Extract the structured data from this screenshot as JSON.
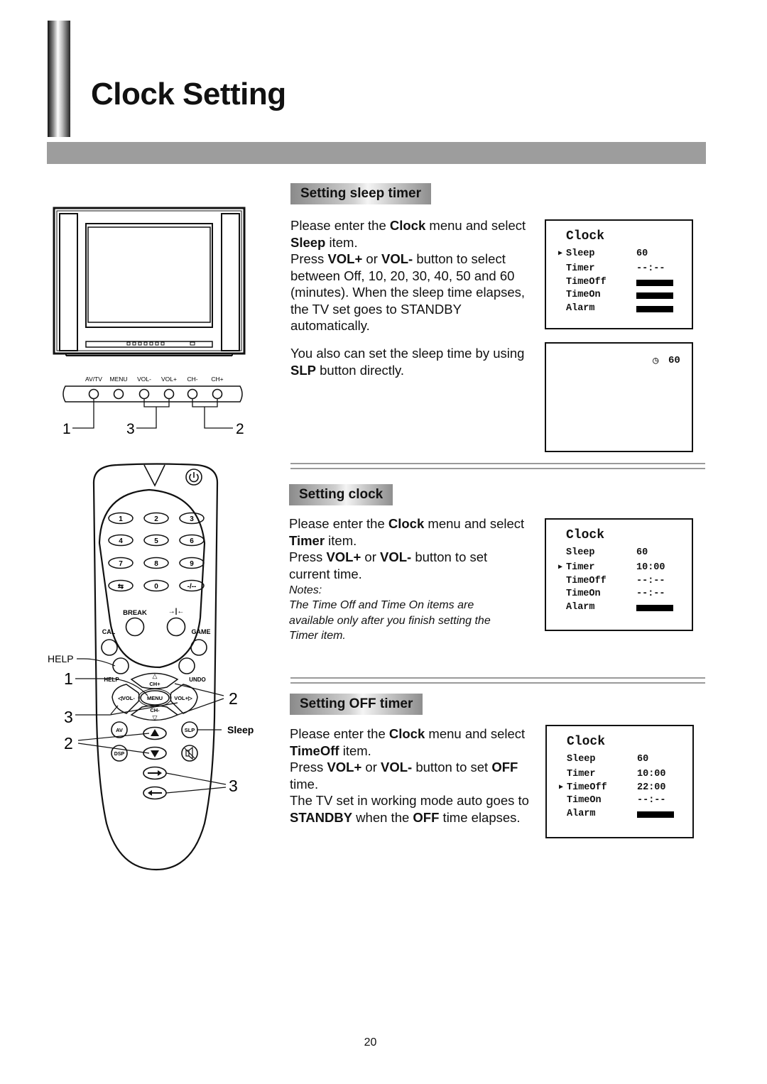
{
  "page": {
    "title": "Clock Setting",
    "page_number": "20"
  },
  "tv_diagram": {
    "panel_buttons": [
      "AV/TV",
      "MENU",
      "VOL-",
      "VOL+",
      "CH-",
      "CH+"
    ],
    "callouts": [
      "1",
      "3",
      "2"
    ]
  },
  "remote_diagram": {
    "keypad": [
      "1",
      "2",
      "3",
      "4",
      "5",
      "6",
      "7",
      "8",
      "9",
      "⇆",
      "0",
      "-/--"
    ],
    "labels": {
      "break": "BREAK",
      "hold": "→|←",
      "cal": "CAL",
      "game": "GAME",
      "help_inner": "HELP",
      "undo": "UNDO",
      "ch_plus": "CH+",
      "ch_minus": "CH-",
      "vol_minus": "◁VOL-",
      "vol_plus": "VOL+▷",
      "menu": "MENU",
      "av": "AV",
      "slp": "SLP",
      "dsp": "DSP"
    },
    "callouts": {
      "help": "HELP",
      "one": "1",
      "two_right": "2",
      "three_left": "3",
      "two_left": "2",
      "sleep": "Sleep",
      "three_right": "3"
    }
  },
  "sections": [
    {
      "heading": "Setting sleep timer",
      "paragraphs": [
        [
          {
            "t": "Please enter the "
          },
          {
            "t": "Clock",
            "b": true
          },
          {
            "t": " menu and select "
          },
          {
            "t": "Sleep",
            "b": true
          },
          {
            "t": " item."
          },
          {
            "br": true
          },
          {
            "t": "Press "
          },
          {
            "t": "VOL+",
            "b": true
          },
          {
            "t": " or "
          },
          {
            "t": "VOL-",
            "b": true
          },
          {
            "t": " button to select between Off, 10, 20, 30, 40, 50 and 60 (minutes). When the sleep time elapses, the TV set goes to STANDBY automatically."
          }
        ],
        [
          {
            "t": "You also can set the sleep time by using "
          },
          {
            "t": "SLP",
            "b": true
          },
          {
            "t": " button directly."
          }
        ]
      ],
      "osd": {
        "title": "Clock",
        "selected": 0,
        "rows": [
          {
            "label": "Sleep",
            "value": "60"
          },
          {
            "label": "Timer",
            "value": "--:--"
          },
          {
            "label": "TimeOff",
            "value": null,
            "bar": true
          },
          {
            "label": "TimeOn",
            "value": null,
            "bar": true
          },
          {
            "label": "Alarm",
            "value": null,
            "bar": true
          }
        ]
      },
      "osd_sleep_indicator": {
        "icon": "clock-icon",
        "value": "60"
      }
    },
    {
      "heading": "Setting clock",
      "paragraphs": [
        [
          {
            "t": "Please enter the "
          },
          {
            "t": "Clock",
            "b": true
          },
          {
            "t": " menu and select "
          },
          {
            "t": "Timer",
            "b": true
          },
          {
            "t": " item."
          },
          {
            "br": true
          },
          {
            "t": "Press "
          },
          {
            "t": "VOL+",
            "b": true
          },
          {
            "t": " or "
          },
          {
            "t": "VOL-",
            "b": true
          },
          {
            "t": " button to set current time."
          }
        ]
      ],
      "notes_title": "Notes:",
      "notes_text": "The Time Off and Time On items are available only after you finish setting the Timer item.",
      "osd": {
        "title": "Clock",
        "selected": 1,
        "rows": [
          {
            "label": "Sleep",
            "value": "60"
          },
          {
            "label": "Timer",
            "value": "10:00"
          },
          {
            "label": "TimeOff",
            "value": "--:--"
          },
          {
            "label": "TimeOn",
            "value": "--:--"
          },
          {
            "label": "Alarm",
            "value": null,
            "bar": true
          }
        ]
      }
    },
    {
      "heading": "Setting OFF timer",
      "paragraphs": [
        [
          {
            "t": "Please enter the "
          },
          {
            "t": "Clock",
            "b": true
          },
          {
            "t": " menu and select "
          },
          {
            "t": "TimeOff",
            "b": true
          },
          {
            "t": " item."
          },
          {
            "br": true
          },
          {
            "t": "Press "
          },
          {
            "t": "VOL+",
            "b": true
          },
          {
            "t": " or "
          },
          {
            "t": "VOL-",
            "b": true
          },
          {
            "t": " button to set "
          },
          {
            "t": "OFF",
            "b": true
          },
          {
            "t": " time."
          },
          {
            "br": true
          },
          {
            "t": "The TV set in working mode auto goes to "
          },
          {
            "t": "STANDBY",
            "b": true
          },
          {
            "t": " when the "
          },
          {
            "t": "OFF",
            "b": true
          },
          {
            "t": " time elapses."
          }
        ]
      ],
      "osd": {
        "title": "Clock",
        "selected": 2,
        "rows": [
          {
            "label": "Sleep",
            "value": "60"
          },
          {
            "label": "Timer",
            "value": "10:00"
          },
          {
            "label": "TimeOff",
            "value": "22:00"
          },
          {
            "label": "TimeOn",
            "value": "--:--"
          },
          {
            "label": "Alarm",
            "value": null,
            "bar": true
          }
        ]
      }
    }
  ]
}
